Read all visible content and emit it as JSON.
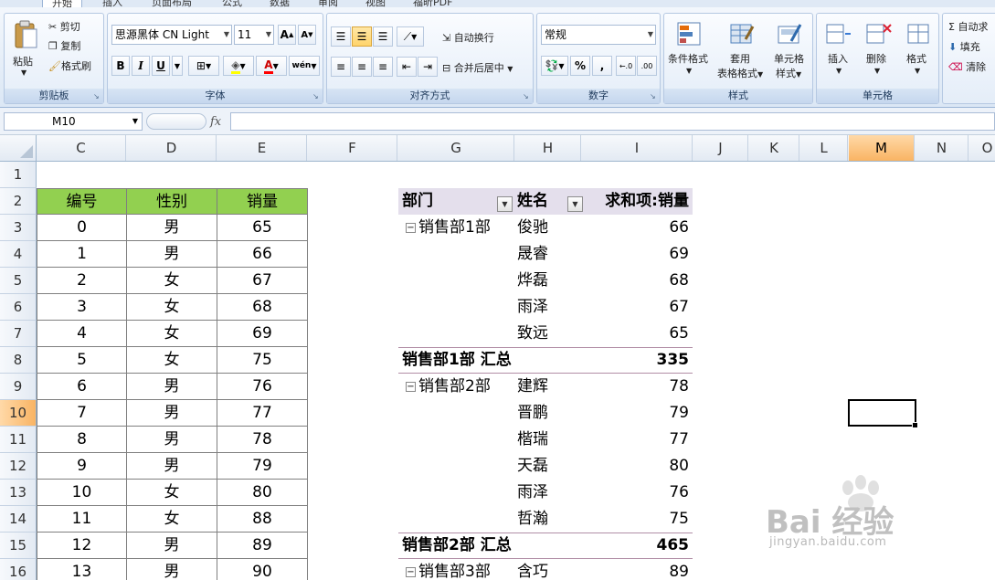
{
  "ribbon": {
    "tabs": [
      "开始",
      "插入",
      "页面布局",
      "公式",
      "数据",
      "审阅",
      "视图",
      "福昕PDF"
    ],
    "clipboard": {
      "paste": "粘贴",
      "cut": "剪切",
      "copy": "复制",
      "format_painter": "格式刷",
      "label": "剪贴板"
    },
    "font": {
      "name": "思源黑体 CN Light",
      "size": "11",
      "bold": "B",
      "italic": "I",
      "underline": "U",
      "label": "字体",
      "grow": "A",
      "shrink": "A",
      "font_color_glyph": "A",
      "phonetic_glyph": "wén"
    },
    "alignment": {
      "wrap": "自动换行",
      "merge": "合并后居中",
      "label": "对齐方式"
    },
    "number": {
      "format": "常规",
      "percent": "%",
      "comma": ",",
      "label": "数字",
      "inc_decimal": "←.0",
      "dec_decimal": ".00"
    },
    "styles": {
      "conditional": "条件格式",
      "table_line1": "套用",
      "table_line2": "表格格式",
      "cell_line1": "单元格",
      "cell_line2": "样式",
      "label": "样式"
    },
    "cells": {
      "insert": "插入",
      "delete": "删除",
      "format": "格式",
      "label": "单元格"
    },
    "editing": {
      "autosum": "Σ 自动求",
      "fill": "填充",
      "clear": "清除"
    }
  },
  "formula_bar": {
    "name_box": "M10",
    "fx": "fx",
    "content": ""
  },
  "columns": [
    "C",
    "D",
    "E",
    "F",
    "G",
    "H",
    "I",
    "J",
    "K",
    "L",
    "M",
    "N",
    "O"
  ],
  "active_column": "M",
  "rows": [
    "1",
    "2",
    "3",
    "4",
    "5",
    "6",
    "7",
    "8",
    "9",
    "10",
    "11",
    "12",
    "13",
    "14",
    "15",
    "16"
  ],
  "active_row": "10",
  "data_table": {
    "headers": [
      "编号",
      "性别",
      "销量"
    ],
    "rows": [
      [
        "0",
        "男",
        "65"
      ],
      [
        "1",
        "男",
        "66"
      ],
      [
        "2",
        "女",
        "67"
      ],
      [
        "3",
        "女",
        "68"
      ],
      [
        "4",
        "女",
        "69"
      ],
      [
        "5",
        "女",
        "75"
      ],
      [
        "6",
        "男",
        "76"
      ],
      [
        "7",
        "男",
        "77"
      ],
      [
        "8",
        "男",
        "78"
      ],
      [
        "9",
        "男",
        "79"
      ],
      [
        "10",
        "女",
        "80"
      ],
      [
        "11",
        "女",
        "88"
      ],
      [
        "12",
        "男",
        "89"
      ],
      [
        "13",
        "男",
        "90"
      ]
    ]
  },
  "pivot": {
    "headers": [
      "部门",
      "姓名",
      "求和项:销量"
    ],
    "rows": [
      {
        "dept": "销售部1部",
        "name": "俊驰",
        "value": "66"
      },
      {
        "dept": "",
        "name": "晟睿",
        "value": "69"
      },
      {
        "dept": "",
        "name": "烨磊",
        "value": "68"
      },
      {
        "dept": "",
        "name": "雨泽",
        "value": "67"
      },
      {
        "dept": "",
        "name": "致远",
        "value": "65"
      },
      {
        "subtotal": "销售部1部 汇总",
        "value": "335"
      },
      {
        "dept": "销售部2部",
        "name": "建辉",
        "value": "78"
      },
      {
        "dept": "",
        "name": "晋鹏",
        "value": "79"
      },
      {
        "dept": "",
        "name": "楷瑞",
        "value": "77"
      },
      {
        "dept": "",
        "name": "天磊",
        "value": "80"
      },
      {
        "dept": "",
        "name": "雨泽",
        "value": "76"
      },
      {
        "dept": "",
        "name": "哲瀚",
        "value": "75"
      },
      {
        "subtotal": "销售部2部 汇总",
        "value": "465"
      },
      {
        "dept": "销售部3部",
        "name": "含巧",
        "value": "89"
      }
    ]
  },
  "watermark": {
    "brand": "Bai 经验",
    "url": "jingyan.baidu.com"
  },
  "colors": {
    "header_green": "#92d050",
    "pivot_header": "#e4dfec",
    "active_header": "#f9b463"
  }
}
